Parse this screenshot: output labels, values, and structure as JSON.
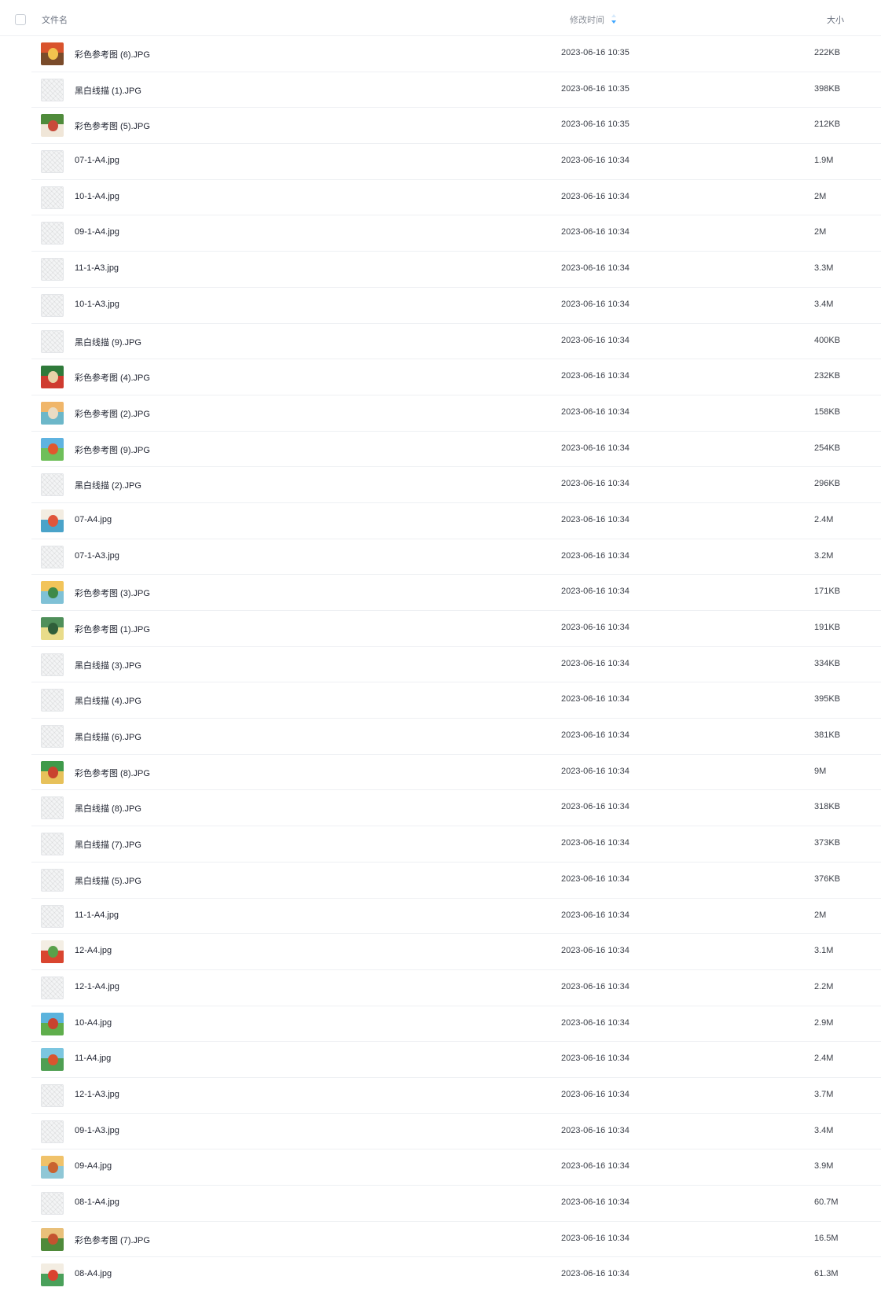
{
  "header": {
    "name_label": "文件名",
    "mtime_label": "修改时间",
    "size_label": "大小",
    "sort_icon": "sort-descending-icon",
    "sort_color": "#3ea6ff"
  },
  "files": [
    {
      "name": "彩色参考图 (6).JPG",
      "mtime": "2023-06-16 10:35",
      "size": "222KB",
      "thumb": "color",
      "palette": [
        "#d9532c",
        "#7a4b2a",
        "#f2c34e"
      ]
    },
    {
      "name": "黑白线描 (1).JPG",
      "mtime": "2023-06-16 10:35",
      "size": "398KB",
      "thumb": "sketch"
    },
    {
      "name": "彩色参考图 (5).JPG",
      "mtime": "2023-06-16 10:35",
      "size": "212KB",
      "thumb": "color",
      "palette": [
        "#4f8b3b",
        "#f0e6d8",
        "#c94a3a"
      ]
    },
    {
      "name": "07-1-A4.jpg",
      "mtime": "2023-06-16 10:34",
      "size": "1.9M",
      "thumb": "sketch"
    },
    {
      "name": "10-1-A4.jpg",
      "mtime": "2023-06-16 10:34",
      "size": "2M",
      "thumb": "sketch"
    },
    {
      "name": "09-1-A4.jpg",
      "mtime": "2023-06-16 10:34",
      "size": "2M",
      "thumb": "sketch"
    },
    {
      "name": "11-1-A3.jpg",
      "mtime": "2023-06-16 10:34",
      "size": "3.3M",
      "thumb": "sketch"
    },
    {
      "name": "10-1-A3.jpg",
      "mtime": "2023-06-16 10:34",
      "size": "3.4M",
      "thumb": "sketch"
    },
    {
      "name": "黑白线描 (9).JPG",
      "mtime": "2023-06-16 10:34",
      "size": "400KB",
      "thumb": "sketch"
    },
    {
      "name": "彩色参考图 (4).JPG",
      "mtime": "2023-06-16 10:34",
      "size": "232KB",
      "thumb": "color",
      "palette": [
        "#2f7a3a",
        "#cf3b2f",
        "#e9d3a8"
      ]
    },
    {
      "name": "彩色参考图 (2).JPG",
      "mtime": "2023-06-16 10:34",
      "size": "158KB",
      "thumb": "color",
      "palette": [
        "#f0b66a",
        "#6cb7c9",
        "#e9dcc4"
      ]
    },
    {
      "name": "彩色参考图 (9).JPG",
      "mtime": "2023-06-16 10:34",
      "size": "254KB",
      "thumb": "color",
      "palette": [
        "#5fb3e0",
        "#6fbf5a",
        "#e2572e"
      ]
    },
    {
      "name": "黑白线描 (2).JPG",
      "mtime": "2023-06-16 10:34",
      "size": "296KB",
      "thumb": "sketch"
    },
    {
      "name": "07-A4.jpg",
      "mtime": "2023-06-16 10:34",
      "size": "2.4M",
      "thumb": "color",
      "palette": [
        "#f3ede2",
        "#4aa3c9",
        "#e0553a"
      ]
    },
    {
      "name": "07-1-A3.jpg",
      "mtime": "2023-06-16 10:34",
      "size": "3.2M",
      "thumb": "sketch"
    },
    {
      "name": "彩色参考图 (3).JPG",
      "mtime": "2023-06-16 10:34",
      "size": "171KB",
      "thumb": "color",
      "palette": [
        "#f2c45a",
        "#7fc1d6",
        "#3f8a4a"
      ]
    },
    {
      "name": "彩色参考图 (1).JPG",
      "mtime": "2023-06-16 10:34",
      "size": "191KB",
      "thumb": "color",
      "palette": [
        "#4f8f5a",
        "#e9dc8a",
        "#2f5f3a"
      ]
    },
    {
      "name": "黑白线描 (3).JPG",
      "mtime": "2023-06-16 10:34",
      "size": "334KB",
      "thumb": "sketch"
    },
    {
      "name": "黑白线描 (4).JPG",
      "mtime": "2023-06-16 10:34",
      "size": "395KB",
      "thumb": "sketch"
    },
    {
      "name": "黑白线描 (6).JPG",
      "mtime": "2023-06-16 10:34",
      "size": "381KB",
      "thumb": "sketch"
    },
    {
      "name": "彩色参考图 (8).JPG",
      "mtime": "2023-06-16 10:34",
      "size": "9M",
      "thumb": "color",
      "palette": [
        "#3f9a4a",
        "#e7c15a",
        "#c9432f"
      ]
    },
    {
      "name": "黑白线描 (8).JPG",
      "mtime": "2023-06-16 10:34",
      "size": "318KB",
      "thumb": "sketch"
    },
    {
      "name": "黑白线描 (7).JPG",
      "mtime": "2023-06-16 10:34",
      "size": "373KB",
      "thumb": "sketch"
    },
    {
      "name": "黑白线描 (5).JPG",
      "mtime": "2023-06-16 10:34",
      "size": "376KB",
      "thumb": "sketch"
    },
    {
      "name": "11-1-A4.jpg",
      "mtime": "2023-06-16 10:34",
      "size": "2M",
      "thumb": "sketch"
    },
    {
      "name": "12-A4.jpg",
      "mtime": "2023-06-16 10:34",
      "size": "3.1M",
      "thumb": "color",
      "palette": [
        "#f4eee4",
        "#d9452f",
        "#5aa04a"
      ]
    },
    {
      "name": "12-1-A4.jpg",
      "mtime": "2023-06-16 10:34",
      "size": "2.2M",
      "thumb": "sketch"
    },
    {
      "name": "10-A4.jpg",
      "mtime": "2023-06-16 10:34",
      "size": "2.9M",
      "thumb": "color",
      "palette": [
        "#5bb3dd",
        "#5fae4c",
        "#c9432f"
      ]
    },
    {
      "name": "11-A4.jpg",
      "mtime": "2023-06-16 10:34",
      "size": "2.4M",
      "thumb": "color",
      "palette": [
        "#7cc6e0",
        "#4f9f52",
        "#d9552f"
      ]
    },
    {
      "name": "12-1-A3.jpg",
      "mtime": "2023-06-16 10:34",
      "size": "3.7M",
      "thumb": "sketch"
    },
    {
      "name": "09-1-A3.jpg",
      "mtime": "2023-06-16 10:34",
      "size": "3.4M",
      "thumb": "sketch"
    },
    {
      "name": "09-A4.jpg",
      "mtime": "2023-06-16 10:34",
      "size": "3.9M",
      "thumb": "color",
      "palette": [
        "#f0c26a",
        "#8fc7d6",
        "#c9632f"
      ]
    },
    {
      "name": "08-1-A4.jpg",
      "mtime": "2023-06-16 10:34",
      "size": "60.7M",
      "thumb": "sketch"
    },
    {
      "name": "彩色参考图 (7).JPG",
      "mtime": "2023-06-16 10:34",
      "size": "16.5M",
      "thumb": "color",
      "palette": [
        "#e9c07a",
        "#4f8a3a",
        "#c4532f"
      ]
    },
    {
      "name": "08-A4.jpg",
      "mtime": "2023-06-16 10:34",
      "size": "61.3M",
      "thumb": "color",
      "palette": [
        "#f3ede2",
        "#4aa05a",
        "#d9432f"
      ]
    }
  ]
}
